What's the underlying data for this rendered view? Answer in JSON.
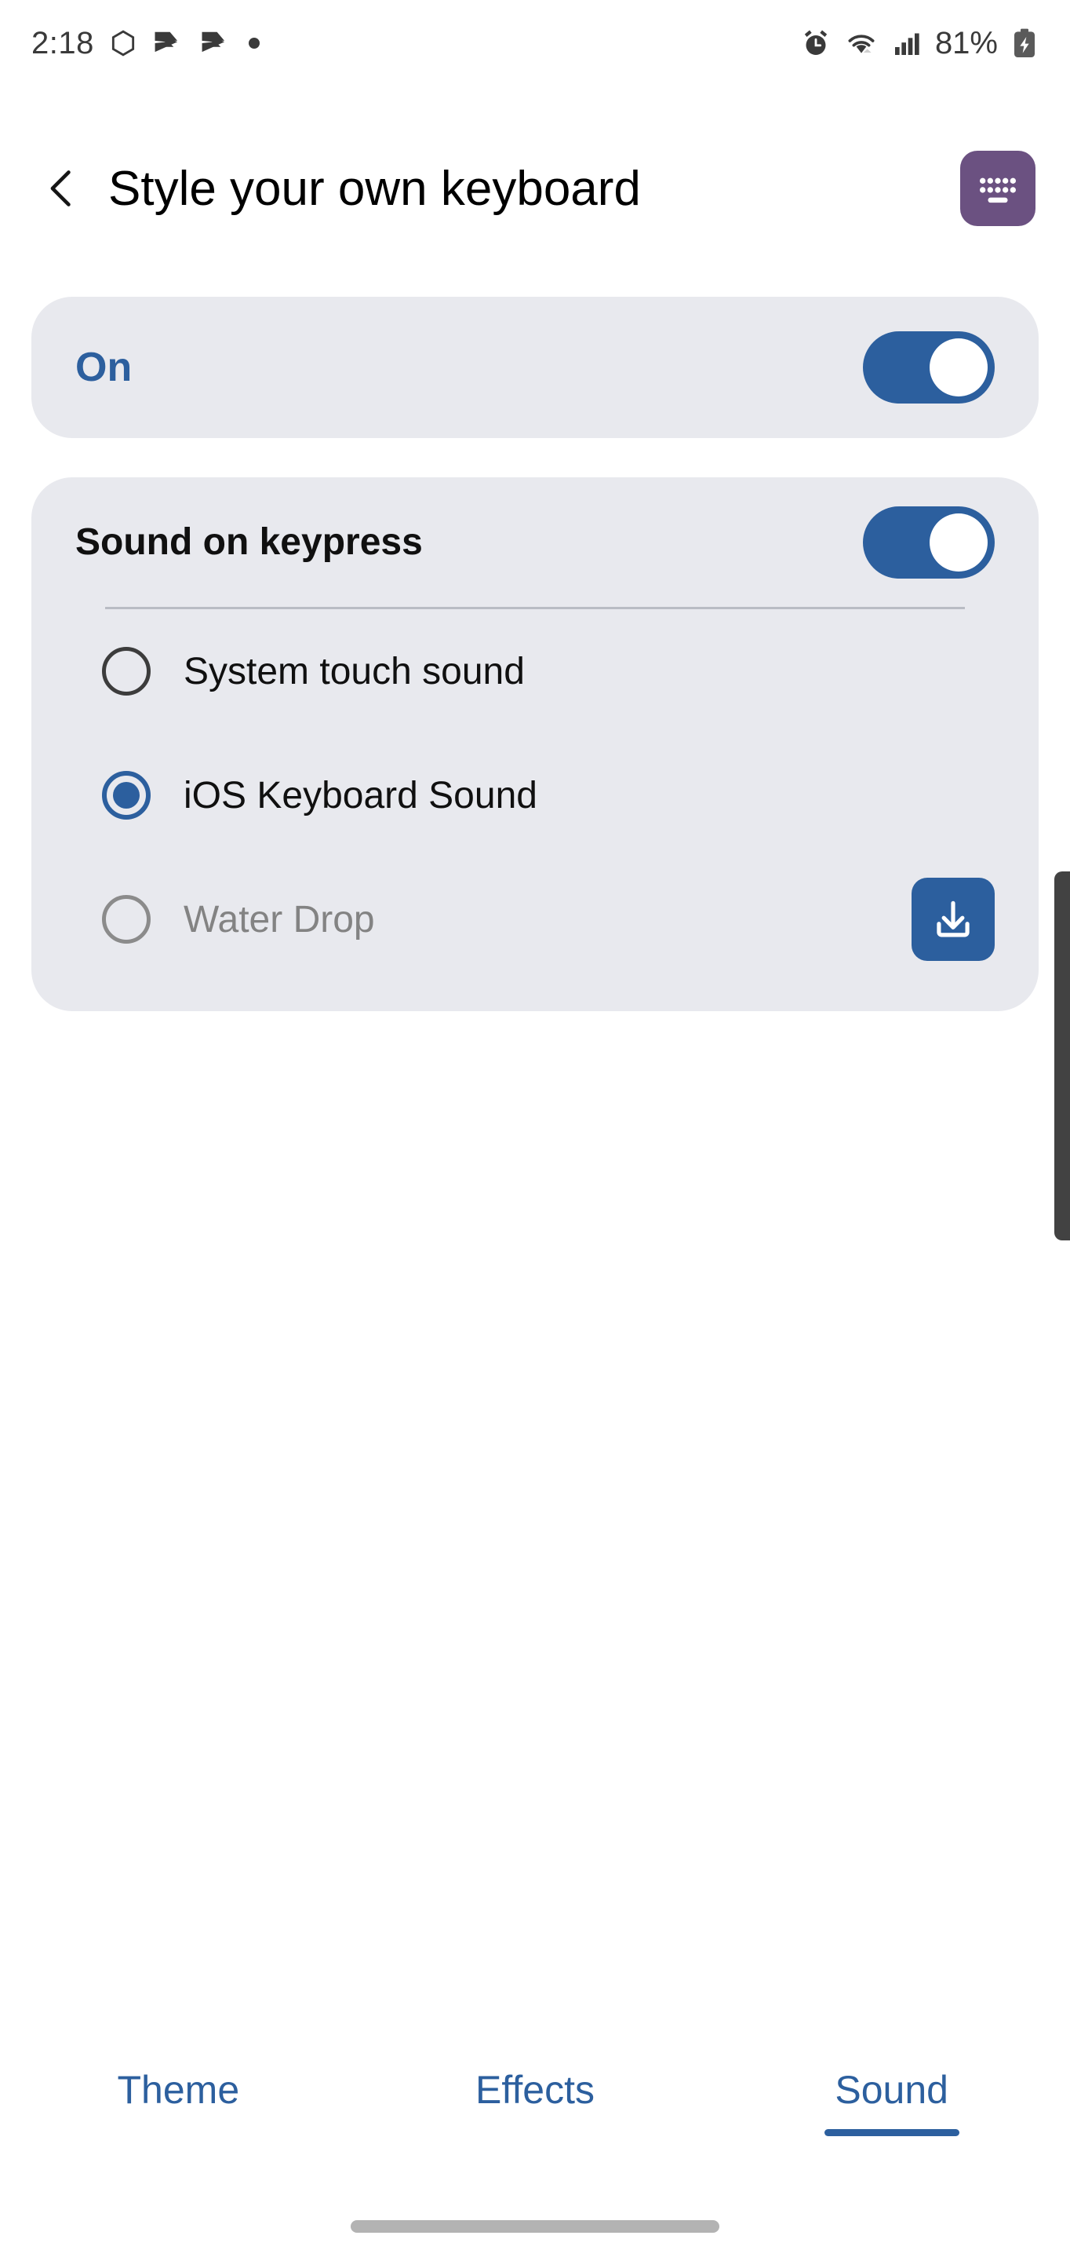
{
  "status_bar": {
    "time": "2:18",
    "battery_percent": "81%",
    "left_icons": [
      "hexagon-icon",
      "chevron-play-icon",
      "chevron-play-icon",
      "dot-icon"
    ],
    "right_icons": [
      "alarm-icon",
      "wifi-icon",
      "signal-bars-icon",
      "battery-charging-icon"
    ]
  },
  "header": {
    "back_icon": "chevron-left-icon",
    "title": "Style your own keyboard",
    "app_icon": "keyboard-icon",
    "app_icon_color": "#6b5181"
  },
  "master_switch": {
    "label": "On",
    "state": "on",
    "accent_color": "#2c5f9e"
  },
  "sound_card": {
    "title": "Sound on keypress",
    "switch_state": "on",
    "options": [
      {
        "label": "System touch sound",
        "selected": false,
        "enabled": true,
        "has_download": false
      },
      {
        "label": "iOS Keyboard Sound",
        "selected": true,
        "enabled": true,
        "has_download": false
      },
      {
        "label": "Water Drop",
        "selected": false,
        "enabled": false,
        "has_download": true,
        "download_icon": "download-icon"
      }
    ]
  },
  "tabs": [
    {
      "label": "Theme",
      "active": false
    },
    {
      "label": "Effects",
      "active": false
    },
    {
      "label": "Sound",
      "active": true
    }
  ],
  "colors": {
    "accent_blue": "#2c5f9e",
    "card_bg": "#e8e9ee",
    "page_bg": "#ffffff",
    "muted_text": "#838383"
  }
}
